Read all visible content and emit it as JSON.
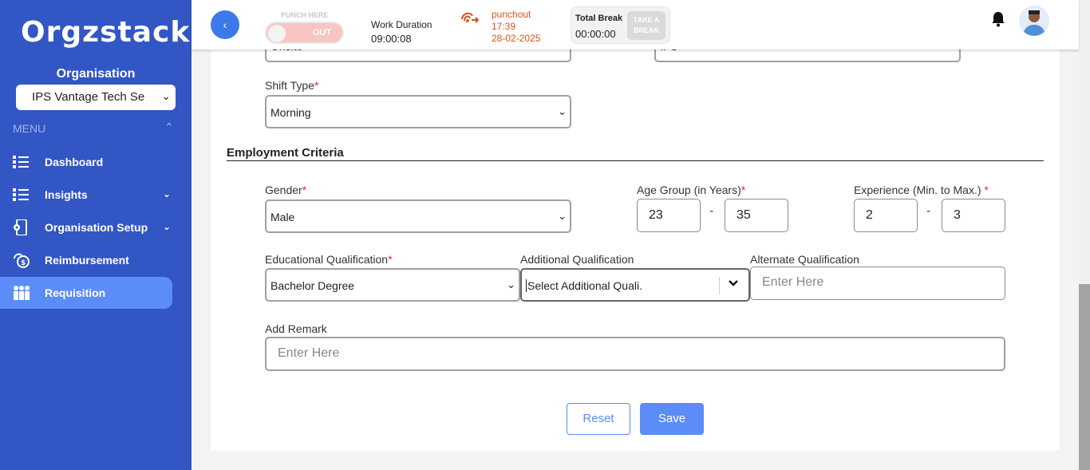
{
  "sidebar": {
    "logo": "Orgzstack",
    "org_label": "Organisation",
    "org_select_value": "IPS Vantage Tech Se",
    "menu_label": "MENU",
    "items": [
      {
        "label": "Dashboard",
        "icon": "dashboard-icon",
        "has_chevron": false,
        "active": false
      },
      {
        "label": "Insights",
        "icon": "insights-icon",
        "has_chevron": true,
        "active": false
      },
      {
        "label": "Organisation Setup",
        "icon": "organisation-setup-icon",
        "has_chevron": true,
        "active": false
      },
      {
        "label": "Reimbursement",
        "icon": "reimbursement-icon",
        "has_chevron": false,
        "active": false
      },
      {
        "label": "Requisition",
        "icon": "requisition-icon",
        "has_chevron": false,
        "active": true
      }
    ]
  },
  "topbar": {
    "punch_label": "PUNCH HERE",
    "punch_toggle_text": "OUT",
    "work_duration_label": "Work Duration",
    "work_duration_value": "09:00:08",
    "punchout_label": "punchout",
    "punchout_time": "17:39",
    "punchout_date": "28-02-2025",
    "total_break_label": "Total Break",
    "total_break_value": "00:00:00",
    "take_break_line1": "TAKE A",
    "take_break_line2": "BREAK"
  },
  "form": {
    "top_left_partial_value": "Onsite",
    "top_right_partial_value": "IPS",
    "shift_type_label": "Shift Type",
    "shift_type_value": "Morning",
    "section_title": "Employment Criteria",
    "gender_label": "Gender",
    "gender_value": "Male",
    "age_group_label": "Age Group (in Years)",
    "age_min": "23",
    "age_max": "35",
    "experience_label": "Experience (Min. to Max.)",
    "exp_min": "2",
    "exp_max": "3",
    "range_separator": "-",
    "required_mark": "*",
    "edu_label": "Educational Qualification",
    "edu_value": "Bachelor Degree",
    "add_qual_label": "Additional Qualification",
    "add_qual_placeholder": "Select Additional Quali.",
    "alt_qual_label": "Alternate Qualification",
    "alt_qual_placeholder": "Enter Here",
    "remark_label": "Add Remark",
    "remark_placeholder": "Enter Here",
    "reset_label": "Reset",
    "save_label": "Save"
  },
  "colors": {
    "sidebar_bg": "#3256c4",
    "active_item": "#5b8cf7",
    "accent": "#3b7ae8",
    "punchout": "#d9531e",
    "required": "#d32f2f"
  }
}
